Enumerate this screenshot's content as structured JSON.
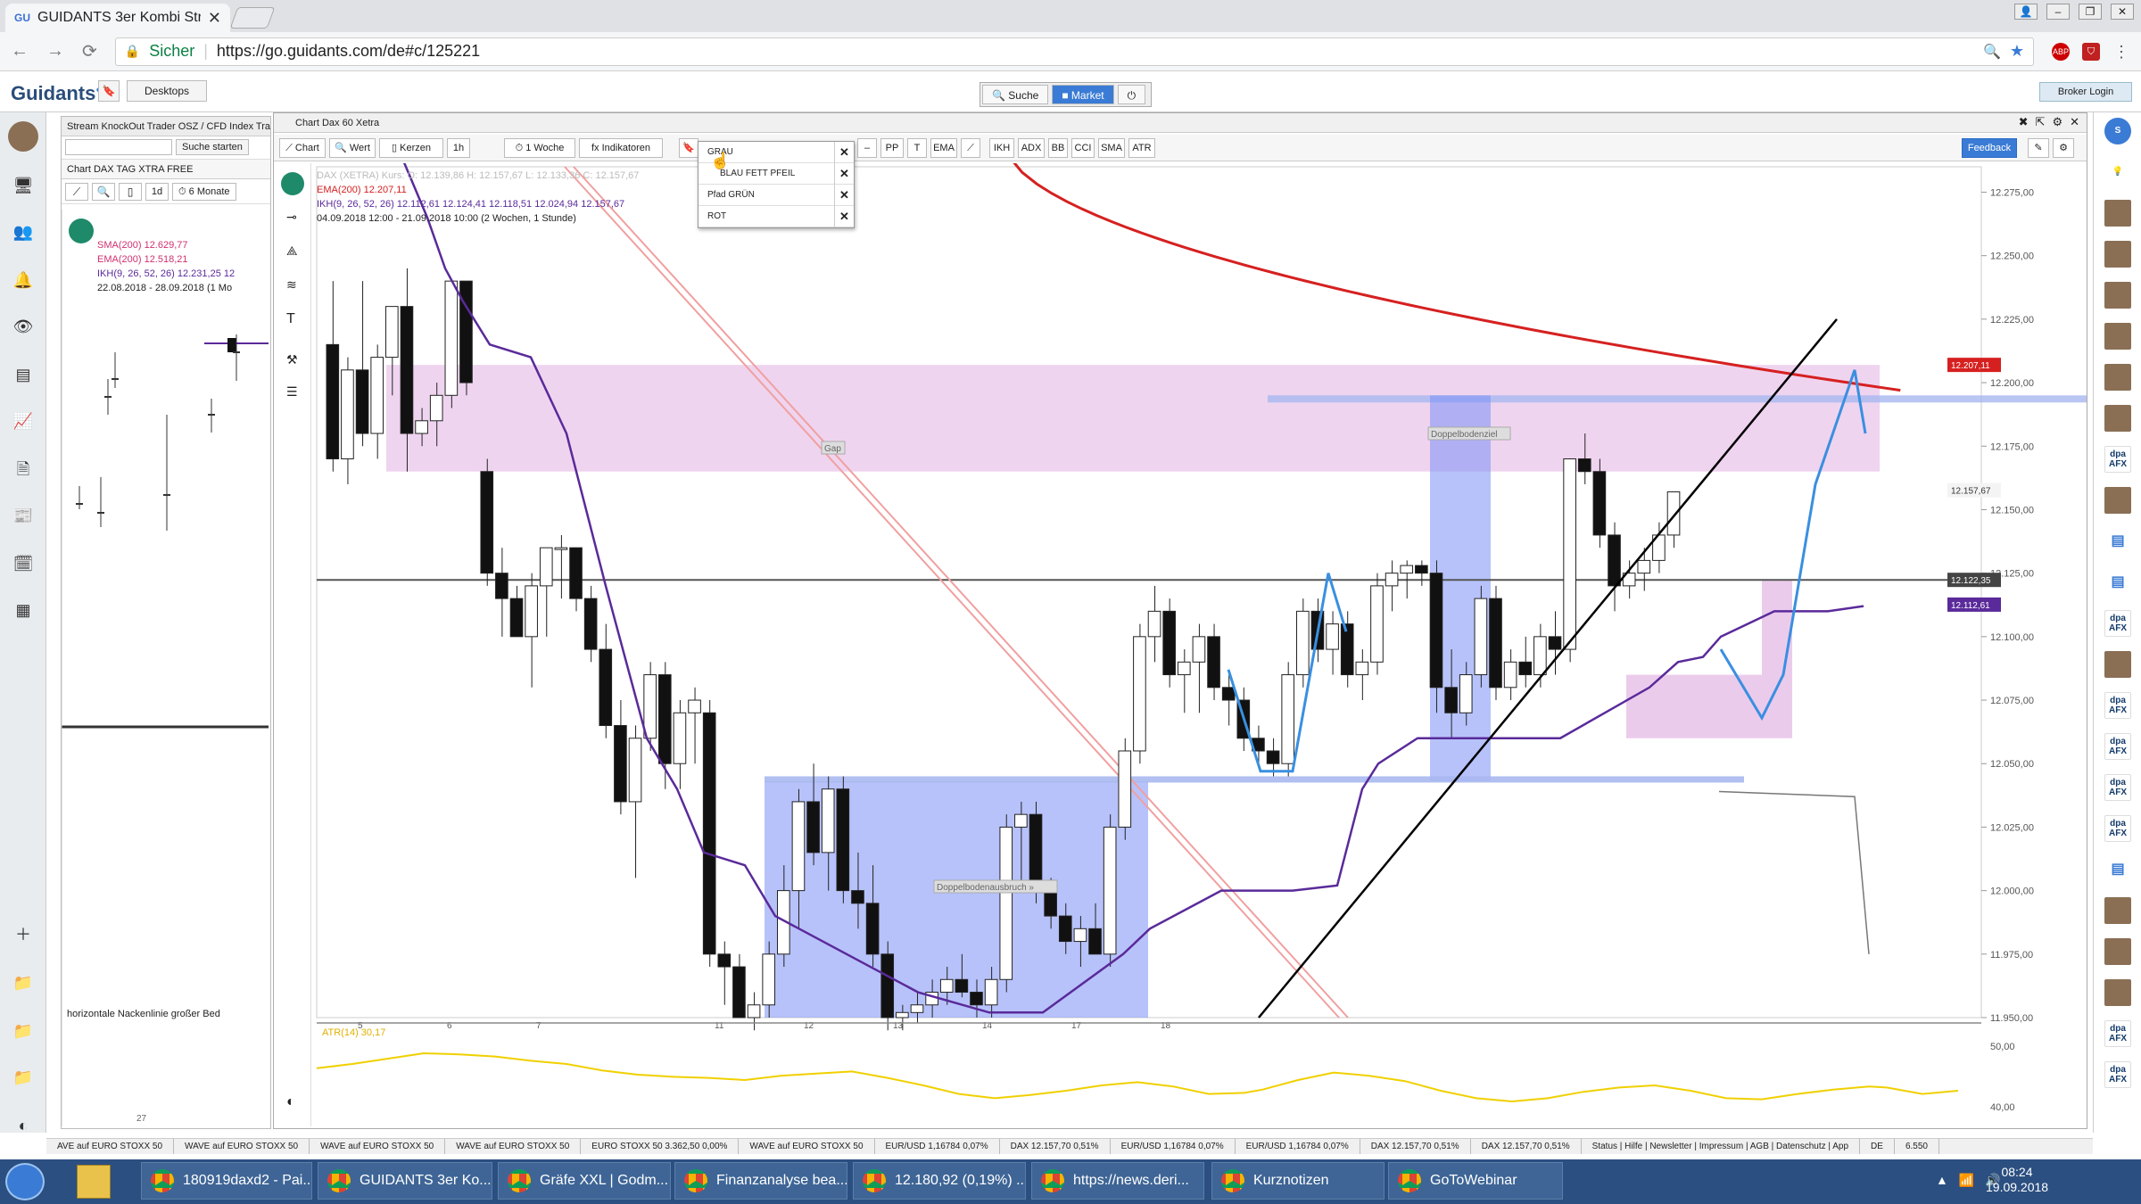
{
  "browser": {
    "tab_title": "GUIDANTS 3er Kombi Str",
    "url": "https://go.guidants.com/de#c/125221",
    "secure_label": "Sicher",
    "ext_abp": "ABP"
  },
  "app": {
    "logo": "Guidants",
    "desktops": "Desktops",
    "search": "Suche",
    "market": "Market",
    "broker": "Broker Login"
  },
  "left_panel": {
    "title": "Stream KnockOut Trader OSZ / CFD Index Trad",
    "search_button": "Suche starten",
    "chart_title": "Chart DAX TAG XTRA FREE",
    "period": "1d",
    "range": "6 Monate",
    "legend": [
      "SMA(200) 12.629,77",
      "EMA(200) 12.518,21",
      "IKH(9, 26, 52, 26) 12.231,25 12"
    ],
    "date_range": "22.08.2018 - 28.09.2018 (1 Mo",
    "annotation": "horizontale Nackenlinie großer Bed",
    "x_label": "27"
  },
  "chart": {
    "window_title": "Chart Dax 60 Xetra",
    "toolbar": {
      "chart": "Chart",
      "wert": "Wert",
      "kerzen": "Kerzen",
      "interval": "1h",
      "range": "1 Woche",
      "indikatoren": "Indikatoren",
      "pp": "PP",
      "ema": "EMA",
      "ikh": "IKH",
      "adx": "ADX",
      "bb": "BB",
      "cci": "CCI",
      "sma": "SMA",
      "atr": "ATR",
      "feedback": "Feedback"
    },
    "dropdown": [
      "GRAU",
      "BLAU FETT PFEIL",
      "Pfad GRÜN",
      "ROT"
    ],
    "legend": {
      "l1": "DAX (XETRA) Kurs: O: 12.139,86 H: 12.157,67 L: 12.133,36 C: 12.157,67",
      "l2": "EMA(200) 12.207,11",
      "l3": "IKH(9, 26, 52, 26) 12.112,61  12.124,41  12.118,51  12.024,94  12.157,67",
      "l4": "04.09.2018 12:00 - 21.09.2018 10:00  (2 Wochen, 1 Stunde)"
    },
    "labels": {
      "gap": "Gap",
      "doppelbodenziel": "Doppelbodenziel",
      "ausbruch": "Doppelbodenausbruch »",
      "atr": "ATR(14) 30,17"
    },
    "price_badges": {
      "ema": "12.207,11",
      "last": "12.157,67",
      "line": "12.122,35",
      "ikh": "12.112,61"
    },
    "colors": {
      "ema": "#d62020",
      "ikh": "#5a2a9a",
      "blue_zone": "#7b8ff5",
      "pink_zone": "#e9c5ea",
      "arrow": "#3a8fe0",
      "atr": "#f0d000"
    }
  },
  "chart_data": {
    "type": "candlestick",
    "y_ticks": [
      "12.275,00",
      "12.250,00",
      "12.225,00",
      "12.200,00",
      "12.175,00",
      "12.150,00",
      "12.125,00",
      "12.100,00",
      "12.075,00",
      "12.050,00",
      "12.025,00",
      "12.000,00",
      "11.975,00",
      "11.950,00"
    ],
    "x_ticks": [
      "5",
      "6",
      "7",
      "11",
      "12",
      "13",
      "14",
      "17",
      "18"
    ],
    "atr_ticks": [
      "50,00",
      "40,00"
    ],
    "ylim": [
      11950,
      12285
    ],
    "candles": [
      [
        12215,
        12240,
        12165,
        12170
      ],
      [
        12170,
        12210,
        12160,
        12205
      ],
      [
        12205,
        12240,
        12175,
        12180
      ],
      [
        12180,
        12215,
        12170,
        12210
      ],
      [
        12210,
        12230,
        12195,
        12230
      ],
      [
        12230,
        12245,
        12165,
        12180
      ],
      [
        12180,
        12190,
        12175,
        12185
      ],
      [
        12185,
        12200,
        12175,
        12195
      ],
      [
        12195,
        12240,
        12190,
        12240
      ],
      [
        12240,
        12240,
        12195,
        12200
      ],
      [
        12165,
        12170,
        12120,
        12125
      ],
      [
        12125,
        12135,
        12100,
        12115
      ],
      [
        12115,
        12120,
        12100,
        12100
      ],
      [
        12100,
        12125,
        12080,
        12120
      ],
      [
        12120,
        12135,
        12100,
        12135
      ],
      [
        12135,
        12140,
        12115,
        12135
      ],
      [
        12135,
        12135,
        12110,
        12115
      ],
      [
        12115,
        12120,
        12090,
        12095
      ],
      [
        12095,
        12105,
        12060,
        12065
      ],
      [
        12065,
        12075,
        12030,
        12035
      ],
      [
        12035,
        12065,
        12005,
        12060
      ],
      [
        12060,
        12090,
        12055,
        12085
      ],
      [
        12085,
        12090,
        12040,
        12050
      ],
      [
        12050,
        12075,
        12040,
        12070
      ],
      [
        12070,
        12080,
        12050,
        12075
      ],
      [
        12070,
        12075,
        11970,
        11975
      ],
      [
        11975,
        11980,
        11955,
        11970
      ],
      [
        11970,
        11975,
        11950,
        11950
      ],
      [
        11950,
        11960,
        11945,
        11955
      ],
      [
        11955,
        11980,
        11950,
        11975
      ],
      [
        11975,
        12010,
        11970,
        12000
      ],
      [
        12000,
        12040,
        11985,
        12035
      ],
      [
        12035,
        12050,
        12010,
        12015
      ],
      [
        12015,
        12045,
        12000,
        12040
      ],
      [
        12040,
        12045,
        11995,
        12000
      ],
      [
        12000,
        12015,
        11985,
        11995
      ],
      [
        11995,
        12010,
        11970,
        11975
      ],
      [
        11975,
        11980,
        11945,
        11950
      ],
      [
        11950,
        11955,
        11945,
        11952
      ],
      [
        11952,
        11960,
        11948,
        11955
      ],
      [
        11955,
        11965,
        11950,
        11960
      ],
      [
        11960,
        11970,
        11955,
        11965
      ],
      [
        11965,
        11975,
        11958,
        11960
      ],
      [
        11960,
        11965,
        11950,
        11955
      ],
      [
        11955,
        11970,
        11950,
        11965
      ],
      [
        11965,
        12030,
        11960,
        12025
      ],
      [
        12025,
        12035,
        12000,
        12030
      ],
      [
        12030,
        12035,
        11995,
        12000
      ],
      [
        12000,
        12005,
        11985,
        11990
      ],
      [
        11990,
        11995,
        11975,
        11980
      ],
      [
        11980,
        11990,
        11970,
        11985
      ],
      [
        11985,
        11995,
        11975,
        11975
      ],
      [
        11975,
        12030,
        11970,
        12025
      ],
      [
        12025,
        12060,
        12020,
        12055
      ],
      [
        12055,
        12105,
        12050,
        12100
      ],
      [
        12100,
        12120,
        12090,
        12110
      ],
      [
        12110,
        12115,
        12080,
        12085
      ],
      [
        12085,
        12095,
        12070,
        12090
      ],
      [
        12090,
        12105,
        12070,
        12100
      ],
      [
        12100,
        12105,
        12075,
        12080
      ],
      [
        12080,
        12085,
        12065,
        12075
      ],
      [
        12075,
        12080,
        12055,
        12060
      ],
      [
        12060,
        12065,
        12050,
        12055
      ],
      [
        12055,
        12060,
        12045,
        12050
      ],
      [
        12050,
        12090,
        12045,
        12085
      ],
      [
        12085,
        12115,
        12080,
        12110
      ],
      [
        12110,
        12115,
        12090,
        12095
      ],
      [
        12095,
        12110,
        12085,
        12105
      ],
      [
        12105,
        12110,
        12080,
        12085
      ],
      [
        12085,
        12095,
        12075,
        12090
      ],
      [
        12090,
        12125,
        12085,
        12120
      ],
      [
        12120,
        12130,
        12110,
        12125
      ],
      [
        12125,
        12130,
        12115,
        12128
      ],
      [
        12128,
        12130,
        12120,
        12125
      ],
      [
        12125,
        12130,
        12070,
        12080
      ],
      [
        12080,
        12095,
        12060,
        12070
      ],
      [
        12070,
        12090,
        12065,
        12085
      ],
      [
        12085,
        12120,
        12080,
        12115
      ],
      [
        12115,
        12120,
        12075,
        12080
      ],
      [
        12080,
        12095,
        12075,
        12090
      ],
      [
        12090,
        12100,
        12080,
        12085
      ],
      [
        12085,
        12105,
        12080,
        12100
      ],
      [
        12100,
        12110,
        12085,
        12095
      ],
      [
        12095,
        12150,
        12090,
        12170
      ],
      [
        12170,
        12180,
        12160,
        12165
      ],
      [
        12165,
        12170,
        12135,
        12140
      ],
      [
        12140,
        12145,
        12110,
        12120
      ],
      [
        12120,
        12130,
        12115,
        12125
      ],
      [
        12125,
        12135,
        12118,
        12130
      ],
      [
        12130,
        12145,
        12125,
        12140
      ],
      [
        12140,
        12157,
        12135,
        12157
      ]
    ]
  },
  "ticker": [
    "AVE auf EURO STOXX 50",
    "WAVE auf EURO STOXX 50",
    "WAVE auf EURO STOXX 50",
    "WAVE auf EURO STOXX 50",
    "EURO STOXX 50 3.362,50 0,00%",
    "WAVE auf EURO STOXX 50",
    "EUR/USD 1,16784 0,07%",
    "DAX 12.157,70 0,51%",
    "EUR/USD 1,16784 0,07%",
    "EUR/USD 1,16784 0,07%",
    "DAX 12.157,70 0,51%",
    "DAX 12.157,70 0,51%",
    "Status | Hilfe | Newsletter | Impressum | AGB | Datenschutz | App",
    "DE",
    "6.550"
  ],
  "taskbar": {
    "items": [
      "180919daxd2 - Pai...",
      "GUIDANTS 3er Ko...",
      "Gräfe XXL | Godm...",
      "Finanzanalyse bea...",
      "12.180,92 (0,19%) ...",
      "https://news.deri...",
      "Kurznotizen",
      "GoToWebinar"
    ],
    "time": "08:24",
    "date": "19.09.2018"
  }
}
